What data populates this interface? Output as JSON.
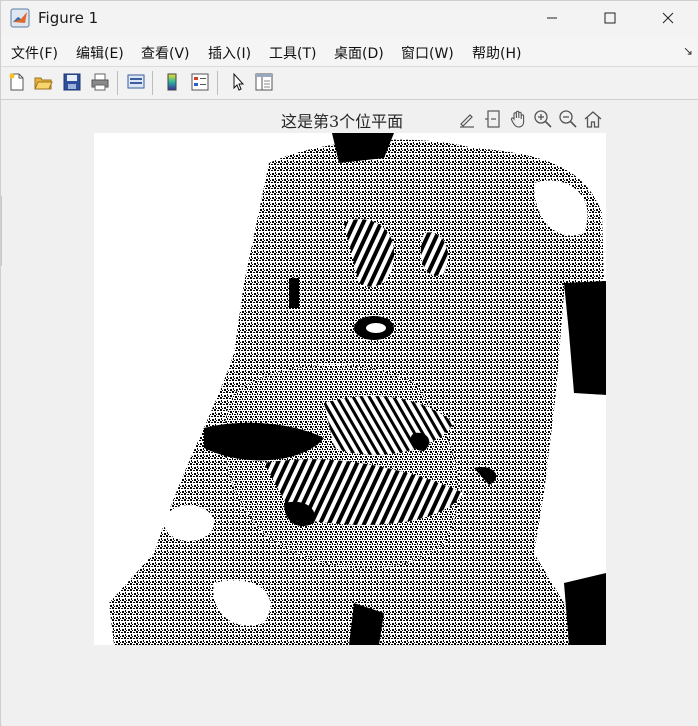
{
  "window": {
    "title": "Figure 1",
    "app_icon": "matlab-icon"
  },
  "controls": {
    "minimize": "minimize-icon",
    "maximize": "maximize-icon",
    "close": "close-icon"
  },
  "menubar": {
    "items": [
      "文件(F)",
      "编辑(E)",
      "查看(V)",
      "插入(I)",
      "工具(T)",
      "桌面(D)",
      "窗口(W)",
      "帮助(H)"
    ],
    "corner_glyph": "↘"
  },
  "toolbar": {
    "buttons": [
      "new-figure-icon",
      "open-file-icon",
      "save-icon",
      "print-icon",
      "link-plot-icon",
      "insert-colorbar-icon",
      "insert-legend-icon",
      "edit-plot-pointer-icon",
      "property-inspector-icon"
    ]
  },
  "plot": {
    "title": "这是第3个位平面",
    "axes_toolbar": [
      "brush-icon",
      "data-tips-icon",
      "pan-hand-icon",
      "zoom-in-icon",
      "zoom-out-icon",
      "restore-view-home-icon"
    ]
  },
  "colors": {
    "background": "#f0f0f0",
    "image_white": "#ffffff",
    "image_black": "#000000"
  }
}
